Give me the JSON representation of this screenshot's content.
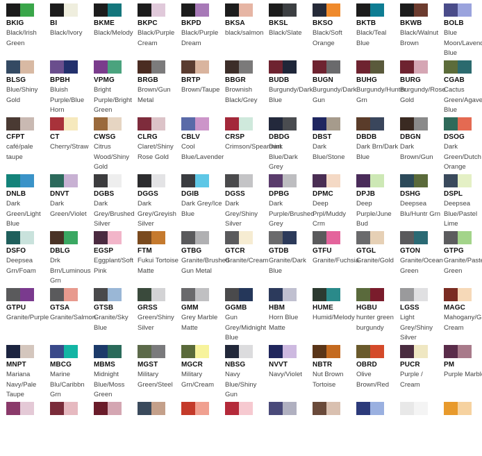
{
  "swatches": [
    {
      "code": "BKIG",
      "name": "Black/Irish Green",
      "colors": [
        "#1b1b1b",
        "#3aa64a"
      ]
    },
    {
      "code": "BI",
      "name": "Black/Ivory",
      "colors": [
        "#1c1c1c",
        "#efeede"
      ]
    },
    {
      "code": "BKME",
      "name": "Black/Melody",
      "colors": [
        "#1c1c1c",
        "#14767c"
      ]
    },
    {
      "code": "BKPC",
      "name": "Black/Purple Cream",
      "colors": [
        "#1c1c1c",
        "#e0c9da"
      ]
    },
    {
      "code": "BKPD",
      "name": "Black/Purple Dream",
      "colors": [
        "#1c1c1c",
        "#a779b7"
      ]
    },
    {
      "code": "BKSA",
      "name": "black/salmon",
      "colors": [
        "#1c1c1c",
        "#e6b5a4"
      ]
    },
    {
      "code": "BKSL",
      "name": "Black/Slate",
      "colors": [
        "#1c1c1c",
        "#3c3f42"
      ]
    },
    {
      "code": "BKSO",
      "name": "Black/Soft Orange",
      "colors": [
        "#252a38",
        "#ef8a2c"
      ]
    },
    {
      "code": "BKTB",
      "name": "Black/Teal Blue",
      "colors": [
        "#1c1c1c",
        "#0e7d93"
      ]
    },
    {
      "code": "BKWB",
      "name": "Black/Walnut Brown",
      "colors": [
        "#1c1c1c",
        "#6c3b2e"
      ]
    },
    {
      "code": "BOLB",
      "name": "Blue Moon/Lavender Blue",
      "colors": [
        "#4a4c8a",
        "#9aa3dd"
      ]
    },
    {
      "code": "BLSG",
      "name": "Blue/Shiny Gold",
      "colors": [
        "#344a63",
        "#d8b9a3"
      ]
    },
    {
      "code": "BPBH",
      "name": "Bluish Purple/Blue Horn",
      "colors": [
        "#6a4e8d",
        "#23306c"
      ]
    },
    {
      "code": "VPMG",
      "name": "Bright Purple/Bright Green",
      "colors": [
        "#7a3c8c",
        "#4aa37e"
      ]
    },
    {
      "code": "BRGB",
      "name": "Brown/Gun Metal",
      "colors": [
        "#4a2c22",
        "#7c7b7c"
      ]
    },
    {
      "code": "BRTP",
      "name": "Brown/Taupe",
      "colors": [
        "#5a3c30",
        "#d9b49e"
      ]
    },
    {
      "code": "BBGR",
      "name": "Brownish Black/Grey",
      "colors": [
        "#3c2e29",
        "#7b7a7a"
      ]
    },
    {
      "code": "BUDB",
      "name": "Burgundy/Dark Blue",
      "colors": [
        "#6e2330",
        "#1f2639"
      ]
    },
    {
      "code": "BUGN",
      "name": "Burgundy/Dark Gun",
      "colors": [
        "#6e2330",
        "#6a6a6c"
      ]
    },
    {
      "code": "BUHG",
      "name": "Burgundy/Hunter Grn",
      "colors": [
        "#6e2330",
        "#5a5a3c"
      ]
    },
    {
      "code": "BURG",
      "name": "Burgundy/Rose Gold",
      "colors": [
        "#6e2330",
        "#d5a6b4"
      ]
    },
    {
      "code": "CGAB",
      "name": "Cactus Green/Agave Blue",
      "colors": [
        "#5c6c3a",
        "#2b6a6e"
      ]
    },
    {
      "code": "CFPT",
      "name": "café/pale taupe",
      "colors": [
        "#4a3a33",
        "#c9b9b2"
      ]
    },
    {
      "code": "CT",
      "name": "Cherry/Straw",
      "colors": [
        "#a8323a",
        "#f6e9bd"
      ]
    },
    {
      "code": "CWSG",
      "name": "Citrus Wood/Shiny Gold",
      "colors": [
        "#9a6a3c",
        "#e6d5c2"
      ]
    },
    {
      "code": "CLRG",
      "name": "Claret/Shiny Rose Gold",
      "colors": [
        "#7e2c3c",
        "#dcc3c8"
      ]
    },
    {
      "code": "CBLV",
      "name": "Cool Blue/Lavender",
      "colors": [
        "#5a6aa8",
        "#cc95c9"
      ]
    },
    {
      "code": "CRSP",
      "name": "Crimson/Spearmint",
      "colors": [
        "#a3283a",
        "#cfe9dc"
      ]
    },
    {
      "code": "DBDG",
      "name": "Dark Blue/Dark Grey",
      "colors": [
        "#23293c",
        "#4a4c50"
      ]
    },
    {
      "code": "DBST",
      "name": "Dark Blue/Stone",
      "colors": [
        "#1f2660",
        "#a69b8c"
      ]
    },
    {
      "code": "DBDB",
      "name": "Dark Brn/Dark Blue",
      "colors": [
        "#5a3c2a",
        "#3a465c"
      ]
    },
    {
      "code": "DBGN",
      "name": "Dark Brown/Gun",
      "colors": [
        "#3a2a22",
        "#8a8a8a"
      ]
    },
    {
      "code": "DSOG",
      "name": "Dark Green/Dutch Orange",
      "colors": [
        "#2f6a5a",
        "#e46a52"
      ]
    },
    {
      "code": "DNLB",
      "name": "Dark Green/Light Blue",
      "colors": [
        "#14837a",
        "#3a93c8"
      ]
    },
    {
      "code": "DNVT",
      "name": "Dark Green/Violet",
      "colors": [
        "#2c6a5c",
        "#c8b1d3"
      ]
    },
    {
      "code": "DGBS",
      "name": "Dark Grey/Brushed Silver",
      "colors": [
        "#3c3c3e",
        "#eeeeee"
      ]
    },
    {
      "code": "DGGS",
      "name": "Dark Grey/Greyish Silver",
      "colors": [
        "#2c2c2e",
        "#e3e3e5"
      ]
    },
    {
      "code": "DGIB",
      "name": "Dark Grey/Ice Blue",
      "colors": [
        "#3a3c40",
        "#5ec7e6"
      ]
    },
    {
      "code": "DGSS",
      "name": "Dark Grey/Shiny Silver",
      "colors": [
        "#4a4a4c",
        "#c4c4c6"
      ]
    },
    {
      "code": "DPBG",
      "name": "Dark Purple/Brushed Grey",
      "colors": [
        "#5a3c6c",
        "#bdbdc0"
      ]
    },
    {
      "code": "DPMC",
      "name": "Deep Prpl/Muddy Crm",
      "colors": [
        "#4a2e54",
        "#f4d9c5"
      ]
    },
    {
      "code": "DPJB",
      "name": "Deep Purple/June Bud",
      "colors": [
        "#4a2c5a",
        "#cde8b5"
      ]
    },
    {
      "code": "DSHG",
      "name": "Deepsea Blu/Huntr Grn",
      "colors": [
        "#2c4a5a",
        "#5a6a3a"
      ]
    },
    {
      "code": "DSPL",
      "name": "Deepsea Blue/Pastel Lime",
      "colors": [
        "#3a4a5c",
        "#e4f0c5"
      ]
    },
    {
      "code": "DSFO",
      "name": "Deepsea Grn/Foam",
      "colors": [
        "#1f5f5c",
        "#c9e2dc"
      ]
    },
    {
      "code": "DBLG",
      "name": "Drk Brn/Luminous Grn",
      "colors": [
        "#4a3326",
        "#3aa862"
      ]
    },
    {
      "code": "EGSP",
      "name": "Eggplant/Soft Pink",
      "colors": [
        "#4a2a40",
        "#f2b5c9"
      ]
    },
    {
      "code": "FTM",
      "name": "Fukui Tortoise Matte",
      "colors": [
        "#7a4a1e",
        "#c57a2e"
      ]
    },
    {
      "code": "GTBG",
      "name": "Granite/Brushed Gun Metal",
      "colors": [
        "#5a5a5c",
        "#b0b0b2"
      ]
    },
    {
      "code": "GTCR",
      "name": "Granite/Cream",
      "colors": [
        "#5a5a5c",
        "#f6ecd2"
      ]
    },
    {
      "code": "GTDB",
      "name": "Granite/Dark Blue",
      "colors": [
        "#6a6a6c",
        "#2c3a5a"
      ]
    },
    {
      "code": "GTFU",
      "name": "Granite/Fuchsia",
      "colors": [
        "#5a5a5c",
        "#e4649c"
      ]
    },
    {
      "code": "GTGL",
      "name": "Granite/Gold",
      "colors": [
        "#6a6a6c",
        "#e6d0b5"
      ]
    },
    {
      "code": "GTON",
      "name": "Granite/Ocean Green",
      "colors": [
        "#5a5a5c",
        "#2a6a74"
      ]
    },
    {
      "code": "GTPG",
      "name": "Granite/Pastel Green",
      "colors": [
        "#5c5c5e",
        "#a3d48a"
      ]
    },
    {
      "code": "GTPU",
      "name": "Granite/Purple",
      "colors": [
        "#5a5a5c",
        "#7a3a8e"
      ]
    },
    {
      "code": "GTSA",
      "name": "Granite/Salmon",
      "colors": [
        "#5a5a5c",
        "#e89a8e"
      ]
    },
    {
      "code": "GTSB",
      "name": "Granite/Sky Blue",
      "colors": [
        "#4a4a4c",
        "#9ab7d6"
      ]
    },
    {
      "code": "GRSS",
      "name": "Green/Shiny Silver",
      "colors": [
        "#3a4a3c",
        "#d3d3d5"
      ]
    },
    {
      "code": "GMM",
      "name": "Grey Marble Matte",
      "colors": [
        "#6a6a6c",
        "#c0c0c2"
      ]
    },
    {
      "code": "GGMB",
      "name": "Gun Grey/Midnight Blue",
      "colors": [
        "#4a4a4c",
        "#25375a"
      ]
    },
    {
      "code": "HBM",
      "name": "Horn Blue Matte",
      "colors": [
        "#2c3a5c",
        "#c0c0d0"
      ]
    },
    {
      "code": "HUME",
      "name": "Humid/Melody",
      "colors": [
        "#2c3a30",
        "#2a8a8a"
      ]
    },
    {
      "code": "HGBU",
      "name": "hunter green burgundy",
      "colors": [
        "#5a6a3c",
        "#7a1c2c"
      ]
    },
    {
      "code": "LGSS",
      "name": "Light Grey/Shiny Silver",
      "colors": [
        "#9a9a9c",
        "#e0e0e2"
      ]
    },
    {
      "code": "MAGC",
      "name": "Mahogany/Ginger Cream",
      "colors": [
        "#7a2c22",
        "#f6d9b8"
      ]
    },
    {
      "code": "MNPT",
      "name": "Mariana Navy/Pale Taupe",
      "colors": [
        "#1c2440",
        "#d4c6bd"
      ]
    },
    {
      "code": "MBCG",
      "name": "Marine Blu/Caribbn Grn",
      "colors": [
        "#3a4a8a",
        "#13b5a4"
      ]
    },
    {
      "code": "MBMS",
      "name": "Midnight Blue/Moss Green",
      "colors": [
        "#1c3a6a",
        "#2a6a5a"
      ]
    },
    {
      "code": "MGST",
      "name": "Military Green/Steel",
      "colors": [
        "#5c6a4a",
        "#7a7a7c"
      ]
    },
    {
      "code": "MGCR",
      "name": "Military Grn/Cream",
      "colors": [
        "#5a6a3a",
        "#f7f39c"
      ]
    },
    {
      "code": "NBSG",
      "name": "Navy Blue/Shiny Gun",
      "colors": [
        "#22283a",
        "#dcdcde"
      ]
    },
    {
      "code": "NVVT",
      "name": "Navy/Violet",
      "colors": [
        "#20265c",
        "#cdb9e0"
      ]
    },
    {
      "code": "NBTR",
      "name": "Nut Brown Tortoise",
      "colors": [
        "#5a3518",
        "#c46a1f"
      ]
    },
    {
      "code": "OBRD",
      "name": "Olive Brown/Red",
      "colors": [
        "#6a5a2c",
        "#d44a2a"
      ]
    },
    {
      "code": "PUCR",
      "name": "Purple / Cream",
      "colors": [
        "#4a2c40",
        "#efe7c2"
      ]
    },
    {
      "code": "PM",
      "name": "Purple Marble",
      "colors": [
        "#5a2c4a",
        "#a87a8a"
      ]
    },
    {
      "code": "",
      "name": "",
      "colors": [
        "#8a3a6a",
        "#e4c9d6"
      ]
    },
    {
      "code": "",
      "name": "",
      "colors": [
        "#7a2c3a",
        "#e6b9c0"
      ]
    },
    {
      "code": "",
      "name": "",
      "colors": [
        "#6a1c2a",
        "#d4a6b2"
      ]
    },
    {
      "code": "",
      "name": "",
      "colors": [
        "#3a4a5c",
        "#c4a08a"
      ]
    },
    {
      "code": "",
      "name": "",
      "colors": [
        "#c43a2a",
        "#f0a090"
      ]
    },
    {
      "code": "",
      "name": "",
      "colors": [
        "#b42a3a",
        "#f6c9d0"
      ]
    },
    {
      "code": "",
      "name": "",
      "colors": [
        "#4a4a7a",
        "#b0b0c0"
      ]
    },
    {
      "code": "",
      "name": "",
      "colors": [
        "#6a4a3a",
        "#d9c0b0"
      ]
    },
    {
      "code": "",
      "name": "",
      "colors": [
        "#2c3a7a",
        "#9ab0e0"
      ]
    },
    {
      "code": "",
      "name": "",
      "colors": [
        "#e8e8e8",
        "#f4f4f4"
      ]
    },
    {
      "code": "",
      "name": "",
      "colors": [
        "#e89a2c",
        "#f6d2a0"
      ]
    }
  ]
}
